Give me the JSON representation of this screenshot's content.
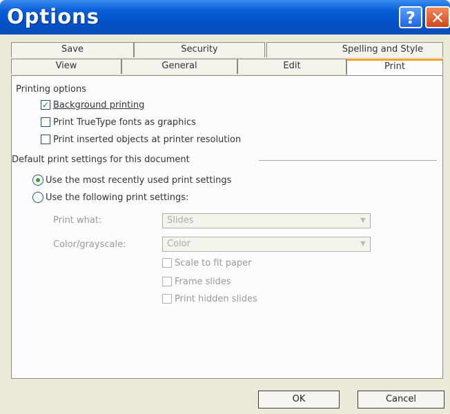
{
  "dialog": {
    "title": "Options",
    "help_glyph": "?",
    "close_glyph": "✕"
  },
  "tabs": {
    "row1": [
      {
        "label": "Save"
      },
      {
        "label": "Security"
      },
      {
        "label": "Spelling and Style"
      }
    ],
    "row2": [
      {
        "label": "View"
      },
      {
        "label": "General"
      },
      {
        "label": "Edit"
      },
      {
        "label": "Print"
      }
    ],
    "active": "Print"
  },
  "printing_options": {
    "heading": "Printing options",
    "background_printing": {
      "label": "Background printing",
      "checked": true
    },
    "truetype_graphics": {
      "label": "Print TrueType fonts as graphics",
      "checked": false
    },
    "inserted_objects": {
      "label": "Print inserted objects at printer resolution",
      "checked": false
    }
  },
  "default_print": {
    "heading": "Default print settings for this document",
    "use_recent": {
      "label": "Use the most recently used print settings",
      "selected": true
    },
    "use_following": {
      "label": "Use the following print settings:",
      "selected": false
    },
    "print_what": {
      "label": "Print what:",
      "value": "Slides"
    },
    "color_grayscale": {
      "label": "Color/grayscale:",
      "value": "Color"
    },
    "scale_to_fit": {
      "label": "Scale to fit paper",
      "checked": false
    },
    "frame_slides": {
      "label": "Frame slides",
      "checked": false
    },
    "hidden_slides": {
      "label": "Print hidden slides",
      "checked": false
    }
  },
  "buttons": {
    "ok": "OK",
    "cancel": "Cancel"
  }
}
